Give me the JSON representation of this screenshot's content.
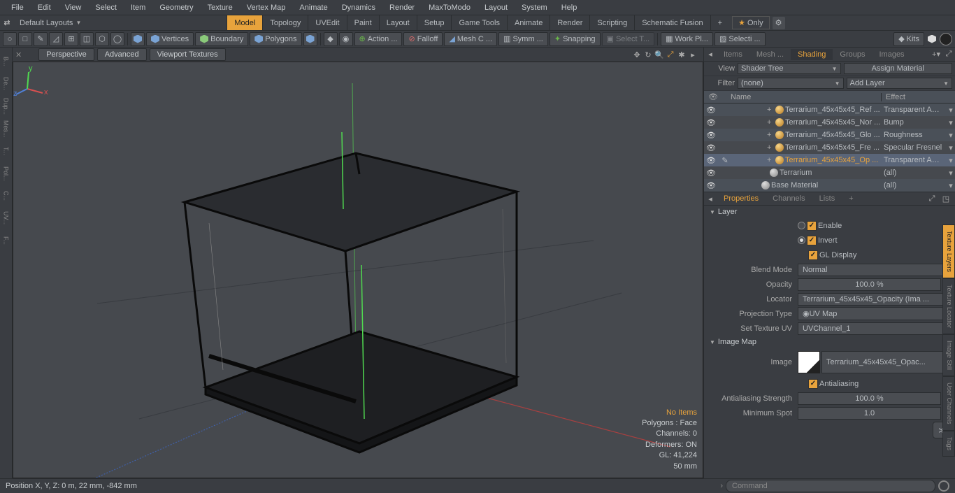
{
  "menu": [
    "File",
    "Edit",
    "View",
    "Select",
    "Item",
    "Geometry",
    "Texture",
    "Vertex Map",
    "Animate",
    "Dynamics",
    "Render",
    "MaxToModo",
    "Layout",
    "System",
    "Help"
  ],
  "layout": {
    "name": "Default Layouts",
    "tabs": [
      "Model",
      "Topology",
      "UVEdit",
      "Paint",
      "Layout",
      "Setup",
      "Game Tools",
      "Animate",
      "Render",
      "Scripting",
      "Schematic Fusion"
    ],
    "only": "Only"
  },
  "toolbar": {
    "vertices": "Vertices",
    "boundary": "Boundary",
    "polygons": "Polygons",
    "action": "Action",
    "falloff": "Falloff",
    "meshc": "Mesh C ...",
    "symm": "Symm ...",
    "snapping": "Snapping",
    "selectt": "Select T...",
    "workpl": "Work Pl...",
    "selecti": "Selecti ...",
    "kits": "Kits"
  },
  "viewport": {
    "tabs": [
      "Perspective",
      "Advanced",
      "Viewport Textures"
    ],
    "info": {
      "noitems": "No Items",
      "polygons": "Polygons : Face",
      "channels": "Channels: 0",
      "deformers": "Deformers: ON",
      "gl": "GL: 41,224",
      "unit": "50 mm"
    }
  },
  "rp_top_tabs": [
    "Items",
    "Mesh ...",
    "Shading",
    "Groups",
    "Images"
  ],
  "shader": {
    "view_lbl": "View",
    "view": "Shader Tree",
    "assign": "Assign Material",
    "filter_lbl": "Filter",
    "filter": "(none)",
    "addlayer": "Add Layer",
    "cols": {
      "name": "Name",
      "effect": "Effect"
    },
    "rows": [
      {
        "n": "Terrarium_45x45x45_Ref ...",
        "e": "Transparent Amo ...",
        "indent": 48,
        "plus": true,
        "ball": "gold"
      },
      {
        "n": "Terrarium_45x45x45_Nor ...",
        "e": "Bump",
        "indent": 48,
        "plus": true,
        "ball": "gold"
      },
      {
        "n": "Terrarium_45x45x45_Glo ...",
        "e": "Roughness",
        "indent": 48,
        "plus": true,
        "ball": "gold"
      },
      {
        "n": "Terrarium_45x45x45_Fre ...",
        "e": "Specular Fresnel",
        "indent": 48,
        "plus": true,
        "ball": "gold"
      },
      {
        "n": "Terrarium_45x45x45_Op ...",
        "e": "Transparent Amo ...",
        "indent": 48,
        "plus": true,
        "ball": "gold",
        "sel": true
      },
      {
        "n": "Terrarium",
        "e": "(all)",
        "indent": 40,
        "plus": false,
        "ball": "grey"
      },
      {
        "n": "Base Material",
        "e": "(all)",
        "indent": 28,
        "plus": false,
        "ball": "grey"
      }
    ]
  },
  "props_tabs": [
    "Properties",
    "Channels",
    "Lists"
  ],
  "props": {
    "layer": "Layer",
    "enable": "Enable",
    "invert": "Invert",
    "gldisplay": "GL Display",
    "blend_lbl": "Blend Mode",
    "blend": "Normal",
    "opacity_lbl": "Opacity",
    "opacity": "100.0 %",
    "locator_lbl": "Locator",
    "locator": "Terrarium_45x45x45_Opacity (Ima ...",
    "proj_lbl": "Projection Type",
    "proj": "UV Map",
    "uv_lbl": "Set Texture UV",
    "uv": "UVChannel_1",
    "imagemap": "Image Map",
    "image_lbl": "Image",
    "image": "Terrarium_45x45x45_Opac...",
    "aa": "Antialiasing",
    "aastr_lbl": "Antialiasing Strength",
    "aastr": "100.0 %",
    "minspot_lbl": "Minimum Spot",
    "minspot": "1.0"
  },
  "side_tabs": [
    "Texture Layers",
    "Texture Locator",
    "Image Still",
    "User Channels",
    "Tags"
  ],
  "status": {
    "pos": "Position X, Y, Z:   0 m, 22 mm, -842 mm",
    "cmd": "Command"
  },
  "left_items": [
    "B...",
    "De...",
    "Dup...",
    "Mes...",
    "T...",
    "Pol...",
    "C...",
    "UV...",
    "F..."
  ]
}
